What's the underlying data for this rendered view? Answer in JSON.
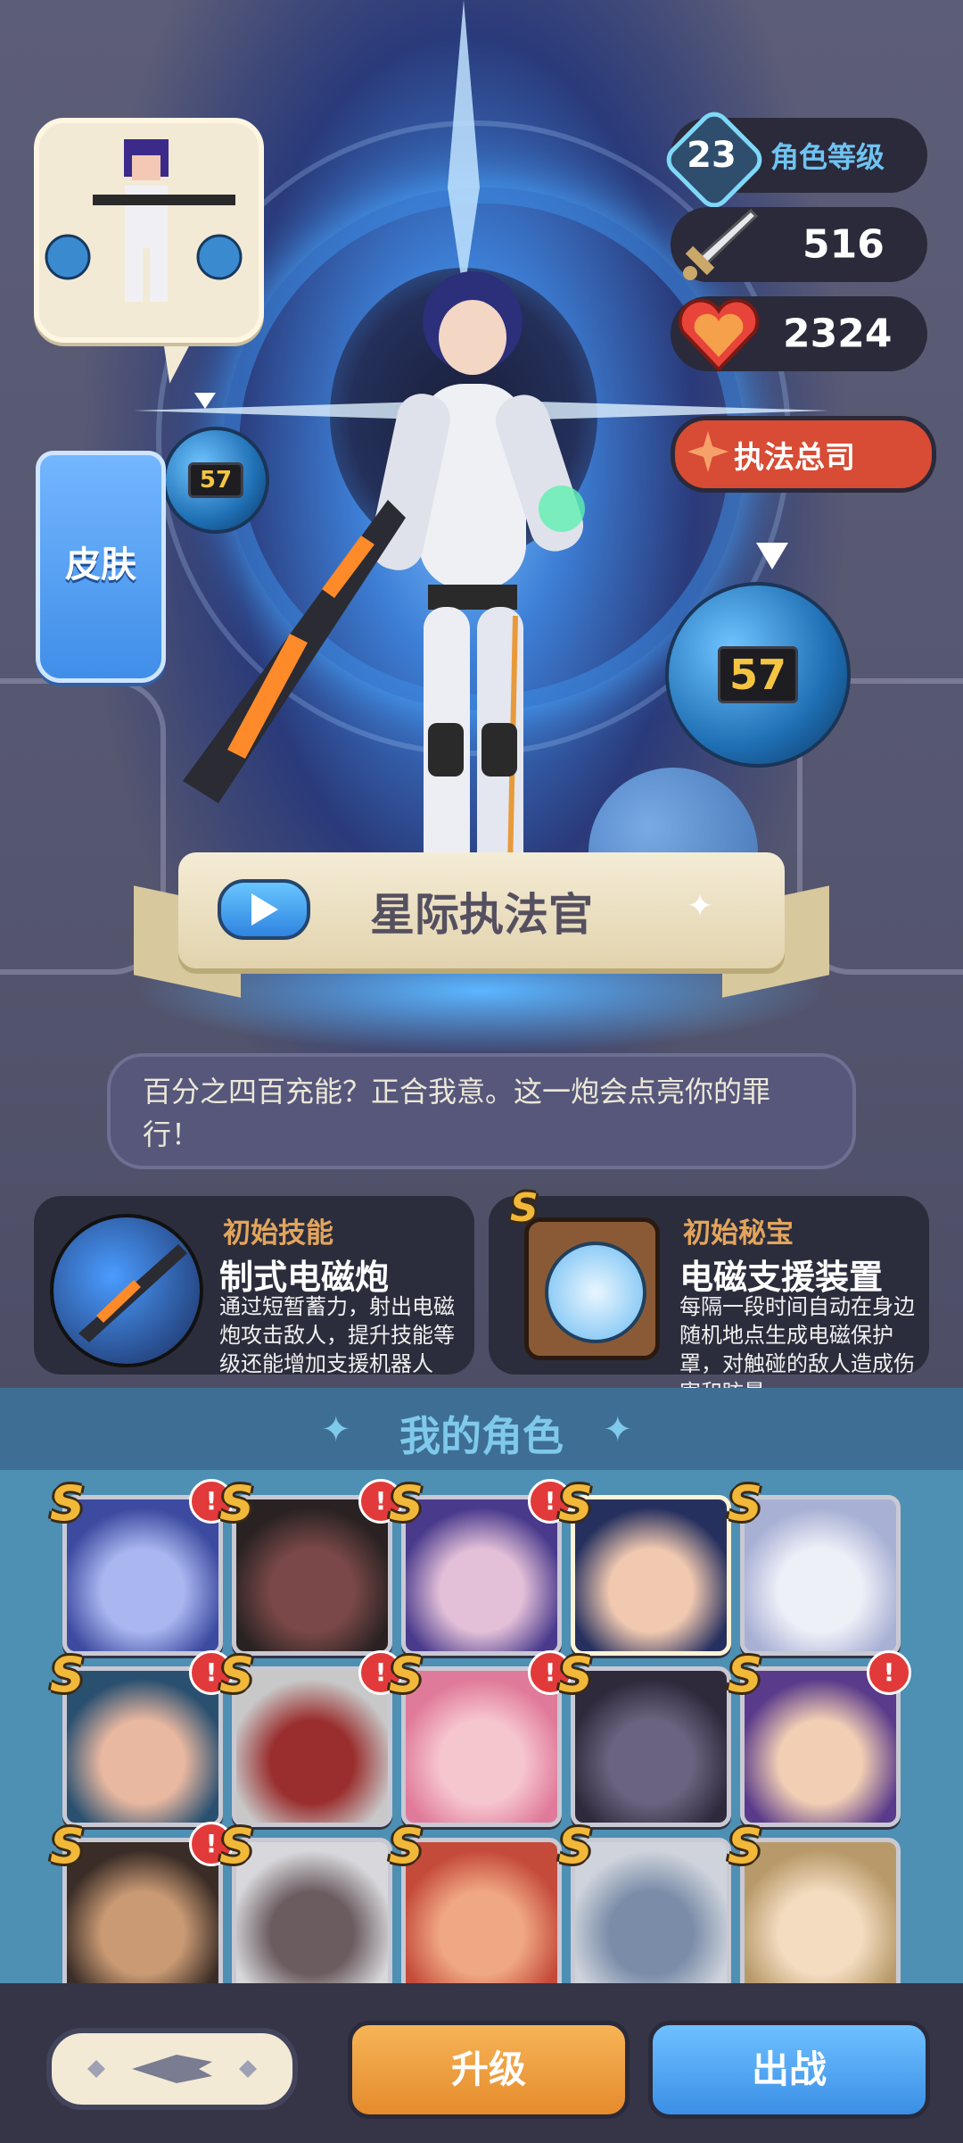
{
  "stats": {
    "level": "23",
    "level_label": "角色等级",
    "attack": "516",
    "health": "2324",
    "faction": "执法总司"
  },
  "drone_number": "57",
  "skin_label": "皮肤",
  "character_name": "星际执法官",
  "quote": "百分之四百充能？正合我意。这一炮会点亮你的罪行！",
  "skill": {
    "category": "初始技能",
    "title": "制式电磁炮",
    "desc": "通过短暂蓄力，射出电磁炮攻击敌人，提升技能等级还能增加支援机器人"
  },
  "treasure": {
    "category": "初始秘宝",
    "title": "电磁支援装置",
    "desc": "每隔一段时间自动在身边随机地点生成电磁保护罩，对触碰的敌人造成伤害和眩晕",
    "rank": "S"
  },
  "my_roles_title": "我的角色",
  "roster": [
    {
      "rank": "S",
      "alert": "!",
      "colors": [
        "#3c4aa0",
        "#a9b6f0"
      ]
    },
    {
      "rank": "S",
      "alert": "!",
      "colors": [
        "#2a2222",
        "#7a4848"
      ]
    },
    {
      "rank": "S",
      "alert": "!",
      "colors": [
        "#4a3a8c",
        "#e3c0d8"
      ]
    },
    {
      "rank": "S",
      "alert": "",
      "colors": [
        "#26305e",
        "#f1c9b0"
      ]
    },
    {
      "rank": "S",
      "alert": "",
      "colors": [
        "#a8b0d4",
        "#eef0f8"
      ]
    },
    {
      "rank": "S",
      "alert": "!",
      "colors": [
        "#2a5070",
        "#e9b8a0"
      ]
    },
    {
      "rank": "S",
      "alert": "!",
      "colors": [
        "#c8c8c8",
        "#9a2e2e"
      ]
    },
    {
      "rank": "S",
      "alert": "!",
      "colors": [
        "#e07a9a",
        "#f6c6cf"
      ]
    },
    {
      "rank": "S",
      "alert": "",
      "colors": [
        "#2e2a3c",
        "#6a6480"
      ]
    },
    {
      "rank": "S",
      "alert": "!",
      "colors": [
        "#5a3a8a",
        "#f2cfb4"
      ]
    },
    {
      "rank": "S",
      "alert": "!",
      "colors": [
        "#3a2c26",
        "#c99a74"
      ]
    },
    {
      "rank": "S",
      "alert": "",
      "colors": [
        "#d8d8dc",
        "#6b5c60"
      ]
    },
    {
      "rank": "S",
      "alert": "",
      "colors": [
        "#c44a3a",
        "#f0a884"
      ]
    },
    {
      "rank": "S",
      "alert": "",
      "colors": [
        "#cfd4dc",
        "#7a8ca8"
      ]
    },
    {
      "rank": "S",
      "alert": "",
      "colors": [
        "#b89a6a",
        "#f3dcc0"
      ]
    }
  ],
  "buttons": {
    "upgrade": "升级",
    "deploy": "出战"
  },
  "accent_colors": {
    "upgrade": "#f0a040",
    "deploy": "#4fa6f0",
    "faction": "#d84b34"
  },
  "icons": {
    "attack": "sword-icon",
    "health": "heart-icon",
    "faction": "star-emblem-icon",
    "play": "play-icon",
    "back": "ornament-back-icon"
  }
}
